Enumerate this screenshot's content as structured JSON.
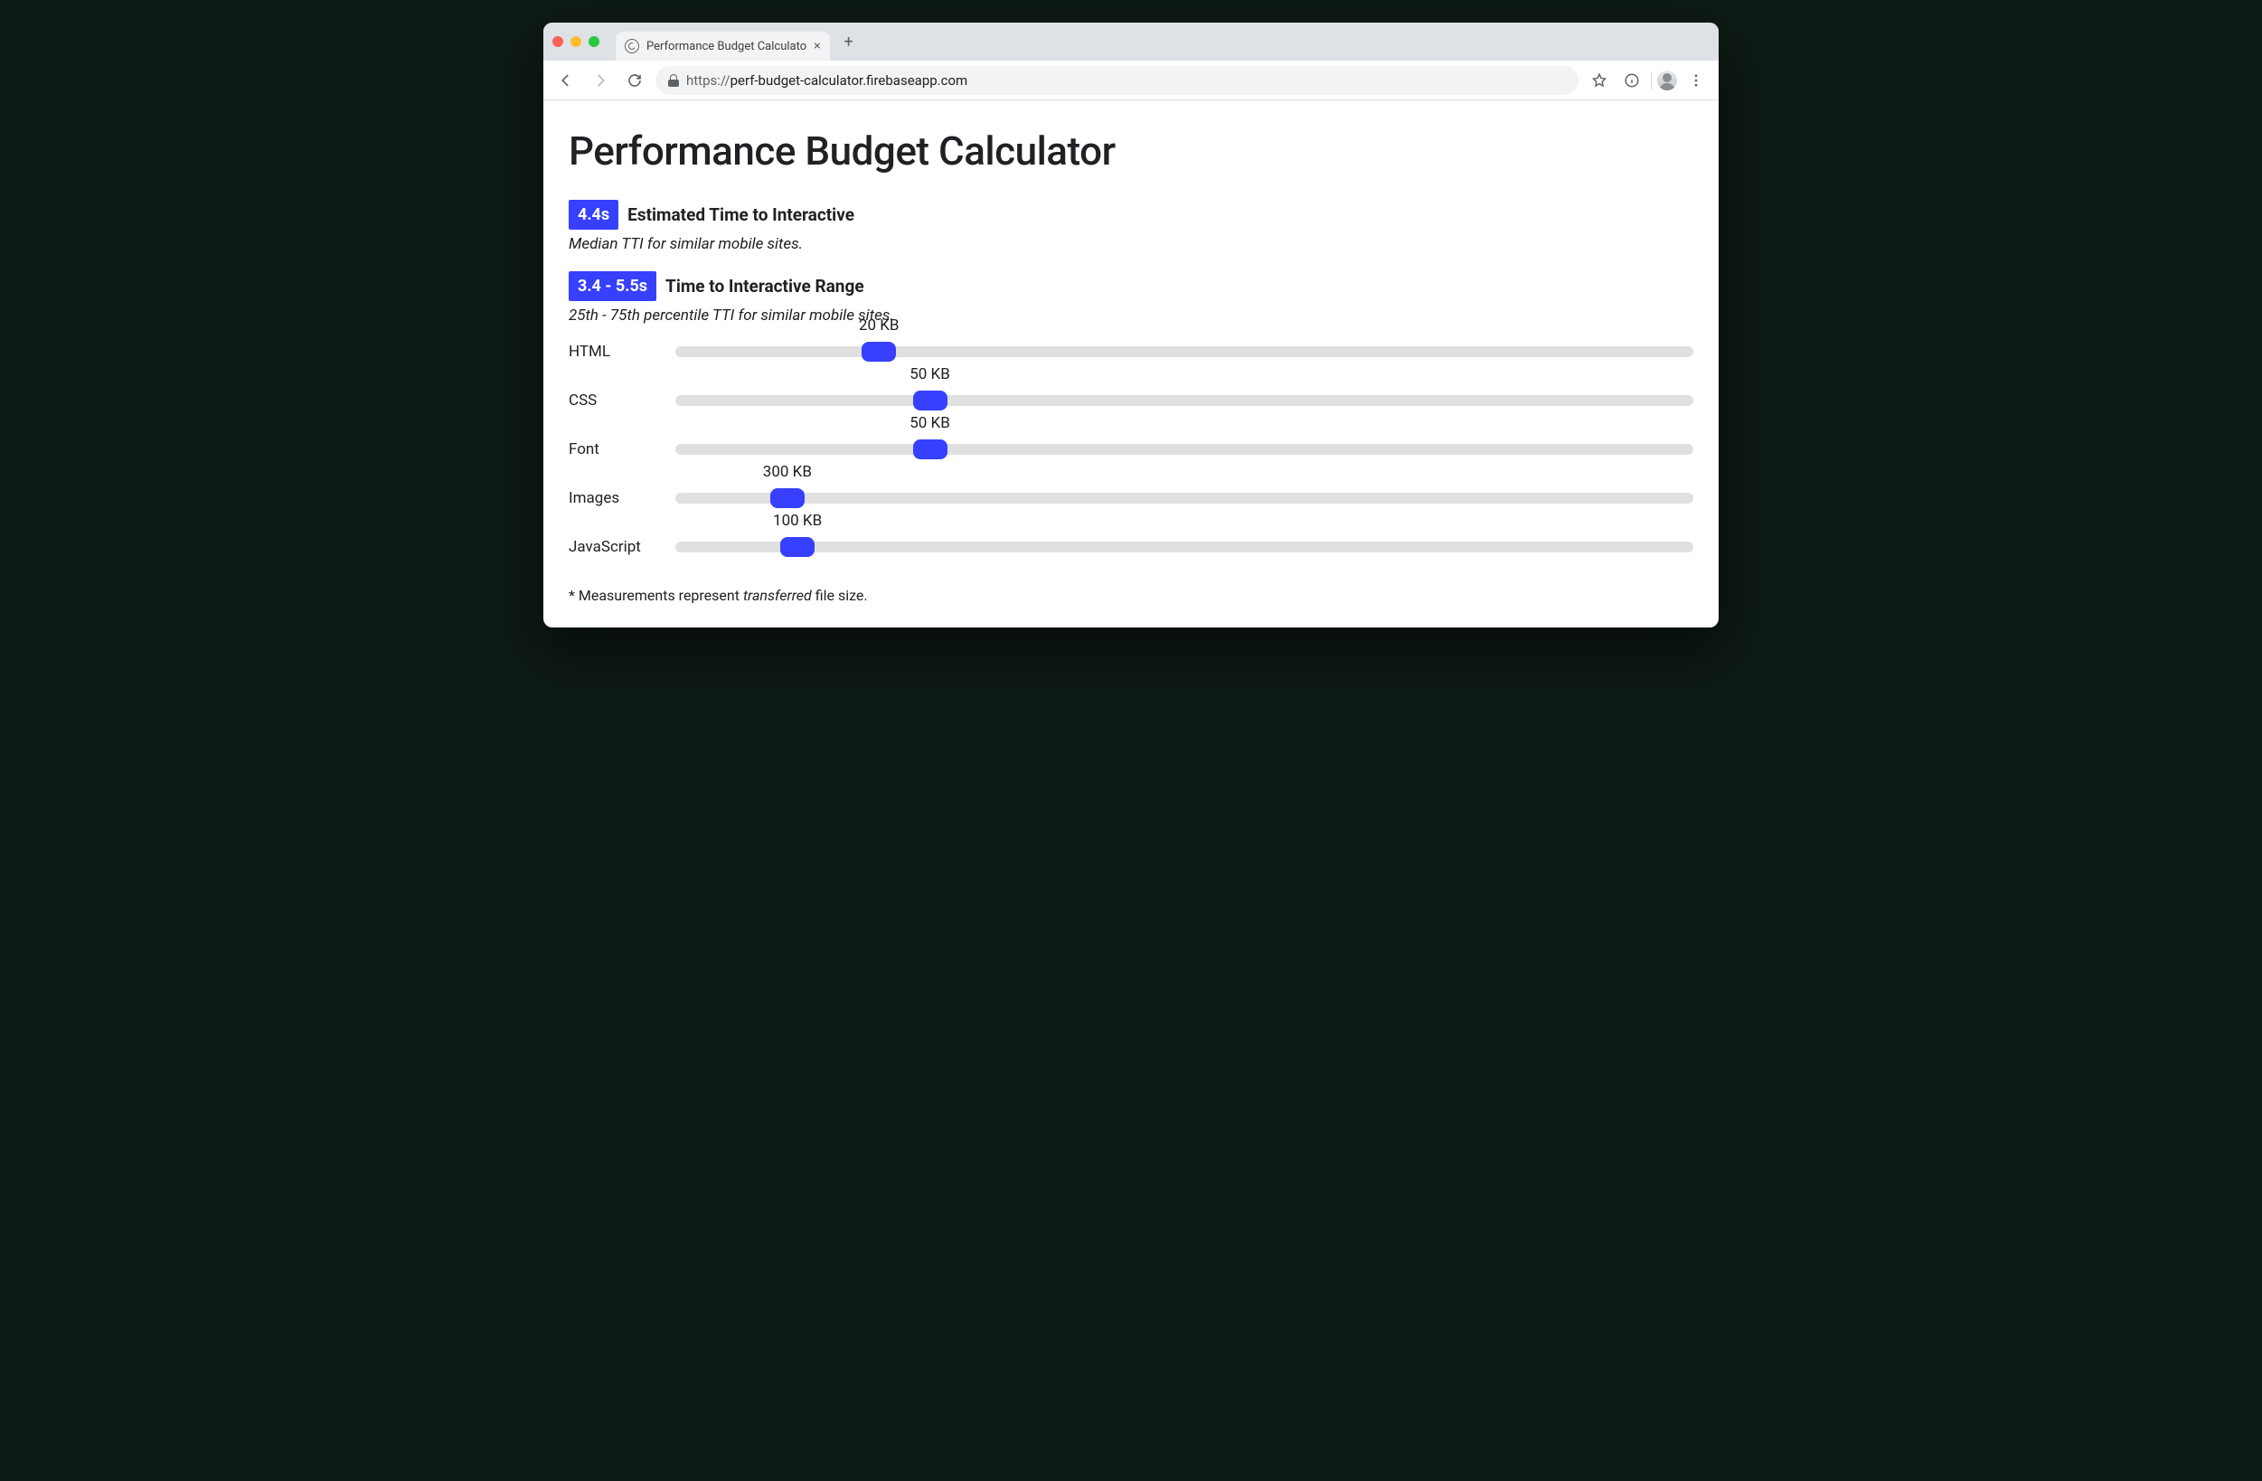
{
  "browser": {
    "tab_title": "Performance Budget Calculato",
    "url_scheme": "https://",
    "url_rest": "perf-budget-calculator.firebaseapp.com"
  },
  "page": {
    "title": "Performance Budget Calculator",
    "metrics": [
      {
        "badge": "4.4s",
        "label": "Estimated Time to Interactive",
        "sub": "Median TTI for similar mobile sites."
      },
      {
        "badge": "3.4 - 5.5s",
        "label": "Time to Interactive Range",
        "sub": "25th - 75th percentile TTI for similar mobile sites."
      }
    ],
    "sliders": [
      {
        "name": "HTML",
        "value_label": "20 KB",
        "pct": 20
      },
      {
        "name": "CSS",
        "value_label": "50 KB",
        "pct": 25
      },
      {
        "name": "Font",
        "value_label": "50 KB",
        "pct": 25
      },
      {
        "name": "Images",
        "value_label": "300 KB",
        "pct": 11
      },
      {
        "name": "JavaScript",
        "value_label": "100 KB",
        "pct": 12
      }
    ],
    "footnote_prefix": "* Measurements represent ",
    "footnote_em": "transferred",
    "footnote_suffix": " file size."
  },
  "chart_data": {
    "type": "bar",
    "title": "Performance Budget Calculator — resource size sliders",
    "categories": [
      "HTML",
      "CSS",
      "Font",
      "Images",
      "JavaScript"
    ],
    "values_kb": [
      20,
      50,
      50,
      300,
      100
    ],
    "unit": "KB",
    "tti_median_s": 4.4,
    "tti_range_s": [
      3.4,
      5.5
    ]
  }
}
